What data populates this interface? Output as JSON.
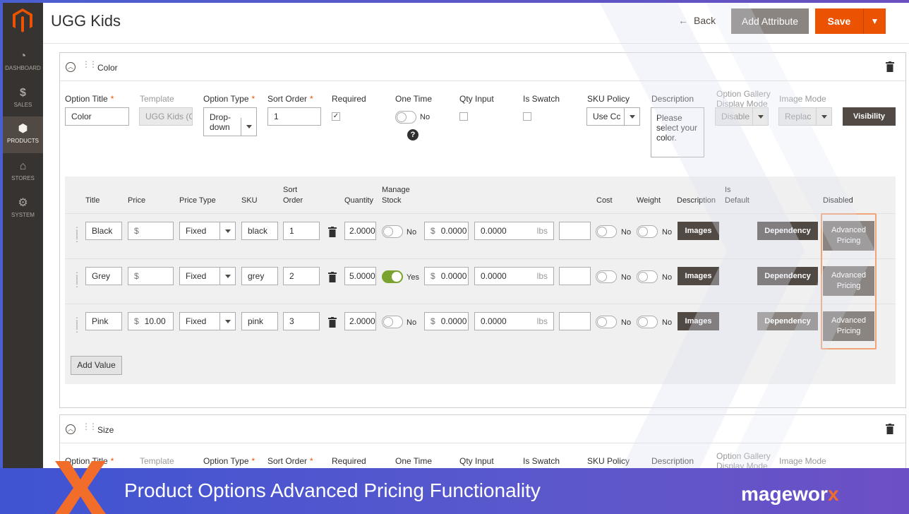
{
  "sidebar": {
    "items": [
      {
        "label": "DASHBOARD",
        "icon": "dashboard-icon"
      },
      {
        "label": "SALES",
        "icon": "dollar-icon"
      },
      {
        "label": "PRODUCTS",
        "icon": "cube-icon",
        "active": true
      },
      {
        "label": "STORES",
        "icon": "store-icon"
      },
      {
        "label": "SYSTEM",
        "icon": "gear-icon"
      }
    ]
  },
  "header": {
    "title": "UGG Kids",
    "back_label": "Back",
    "add_attribute_label": "Add Attribute",
    "save_label": "Save"
  },
  "option_labels": {
    "option_title": "Option Title",
    "template": "Template",
    "option_type": "Option Type",
    "sort_order": "Sort Order",
    "required": "Required",
    "one_time": "One Time",
    "qty_input": "Qty Input",
    "is_swatch": "Is Swatch",
    "sku_policy": "SKU Policy",
    "description": "Description",
    "gallery_line1": "Option Gallery",
    "gallery_line2": "Display Mode",
    "image_mode": "Image Mode",
    "required_mark": "*"
  },
  "color_option": {
    "title": "Color",
    "option_title_value": "Color",
    "template_value": "UGG Kids (C",
    "option_type_line1": "Drop-",
    "option_type_line2": "down",
    "sort_order_value": "1",
    "required_checked": true,
    "one_time_label": "No",
    "sku_policy_value": "Use Cc",
    "description_value": "Please select your color.",
    "gallery_value": "Disable",
    "image_mode_value": "Replac",
    "visibility_label": "Visibility"
  },
  "values_headers": {
    "title": "Title",
    "price": "Price",
    "price_type": "Price Type",
    "sku": "SKU",
    "sort_line1": "Sort",
    "sort_line2": "Order",
    "quantity": "Quantity",
    "manage_line1": "Manage",
    "manage_line2": "Stock",
    "cost": "Cost",
    "weight": "Weight",
    "description": "Description",
    "is_line1": "Is",
    "is_line2": "Default",
    "disabled": "Disabled"
  },
  "values": [
    {
      "title": "Black",
      "price": "",
      "price_type": "Fixed",
      "sku": "black",
      "sort_order": "1",
      "quantity": "2.0000",
      "manage_stock": "No",
      "manage_on": false,
      "cost": "0.0000",
      "weight": "0.0000",
      "weight_unit": "lbs",
      "is_default": "No",
      "disabled": "No",
      "images": "Images",
      "dependency": "Dependency",
      "adv_line1": "Advanced",
      "adv_line2": "Pricing"
    },
    {
      "title": "Grey",
      "price": "",
      "price_type": "Fixed",
      "sku": "grey",
      "sort_order": "2",
      "quantity": "5.0000",
      "manage_stock": "Yes",
      "manage_on": true,
      "cost": "0.0000",
      "weight": "0.0000",
      "weight_unit": "lbs",
      "is_default": "No",
      "disabled": "No",
      "images": "Images",
      "dependency": "Dependency",
      "adv_line1": "Advanced",
      "adv_line2": "Pricing"
    },
    {
      "title": "Pink",
      "price": "10.00",
      "price_type": "Fixed",
      "sku": "pink",
      "sort_order": "3",
      "quantity": "2.0000",
      "manage_stock": "No",
      "manage_on": false,
      "cost": "0.0000",
      "weight": "0.0000",
      "weight_unit": "lbs",
      "is_default": "No",
      "disabled": "No",
      "images": "Images",
      "dependency": "Dependency",
      "adv_line1": "Advanced",
      "adv_line2": "Pricing"
    }
  ],
  "currency_symbol": "$",
  "add_value_label": "Add Value",
  "size_option": {
    "title": "Size"
  },
  "banner": {
    "text": "Product Options Advanced Pricing Functionality",
    "brand_main": "magewor",
    "brand_x": "x"
  },
  "colors": {
    "accent": "#eb5202",
    "sidebar": "#373330",
    "highlight": "#f0a478",
    "toggle_on": "#79a22e"
  }
}
